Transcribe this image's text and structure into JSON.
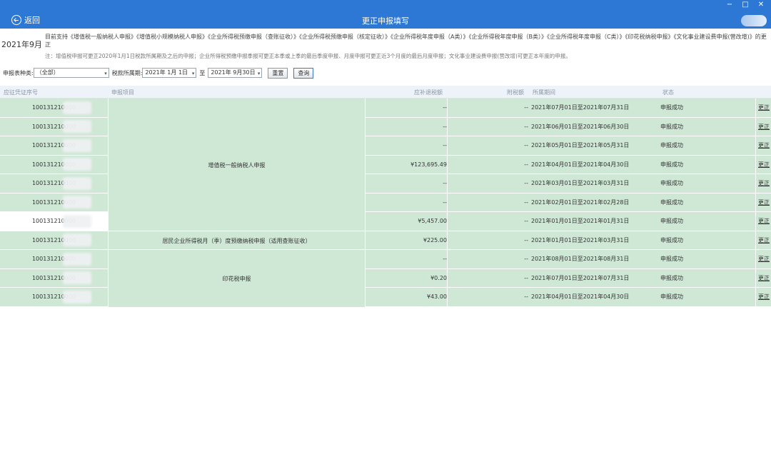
{
  "window": {
    "back_label": "返回",
    "title": "更正申报填写",
    "minimize": "−",
    "maximize": "□",
    "close": "✕"
  },
  "info": {
    "period": "2021年9月",
    "support_text": "目前支持《增值税一般纳税人申报》《增值税小规模纳税人申报》《企业所得税预缴申报（查账征收）》《企业所得税预缴申报（核定征收）》《企业所得税年度申报（A类）》《企业所得税年度申报（B类）》《企业所得税年度申报（C类）》《印花税纳税申报》《文化事业建设费申报(营改增)》的更正",
    "note": "注：增值税申报可更正2020年1月1日税款所属期及之后的申报；企业所得税预缴申报季报可更正本季或上季的最后季度申报、月度申报可更正近3个月度的最后月度申报；文化事业建设费申报(营改增)可更正本年度的申报。"
  },
  "filters": {
    "type_label": "申报表种类:",
    "type_value": "（全部）",
    "period_label": "税款所属期:",
    "start_date": "2021年 1月 1日",
    "to_label": "至",
    "end_date": "2021年 9月30日",
    "reset_label": "重置",
    "query_label": "查询"
  },
  "table": {
    "columns": {
      "id": "应征凭证序号",
      "item": "申报项目",
      "amount": "应补退税额",
      "surtax": "附税额",
      "period": "所属期间",
      "status": "状态"
    },
    "groups": [
      {
        "name": "增值税一般纳税人申报"
      },
      {
        "name": "居民企业所得税月（季）度预缴纳税申报（适用查账征收）"
      },
      {
        "name": "印花税申报"
      }
    ],
    "rows": [
      {
        "id": "100131210000",
        "amount": "--",
        "surtax": "--",
        "period": "2021年07月01日至2021年07月31日",
        "status": "申报成功",
        "action": "更正"
      },
      {
        "id": "100131210000",
        "amount": "--",
        "surtax": "--",
        "period": "2021年06月01日至2021年06月30日",
        "status": "申报成功",
        "action": "更正"
      },
      {
        "id": "100131210000",
        "amount": "--",
        "surtax": "--",
        "period": "2021年05月01日至2021年05月31日",
        "status": "申报成功",
        "action": "更正"
      },
      {
        "id": "100131210000",
        "amount": "¥123,695.49",
        "surtax": "--",
        "period": "2021年04月01日至2021年04月30日",
        "status": "申报成功",
        "action": "更正"
      },
      {
        "id": "100131210000",
        "amount": "--",
        "surtax": "--",
        "period": "2021年03月01日至2021年03月31日",
        "status": "申报成功",
        "action": "更正"
      },
      {
        "id": "100131210000",
        "amount": "--",
        "surtax": "--",
        "period": "2021年02月01日至2021年02月28日",
        "status": "申报成功",
        "action": "更正"
      },
      {
        "id": "100131210000",
        "amount": "¥5,457.00",
        "surtax": "--",
        "period": "2021年01月01日至2021年01月31日",
        "status": "申报成功",
        "action": "更正"
      },
      {
        "id": "100131210000",
        "amount": "¥225.00",
        "surtax": "--",
        "period": "2021年01月01日至2021年03月31日",
        "status": "申报成功",
        "action": "更正"
      },
      {
        "id": "100131210000",
        "amount": "--",
        "surtax": "--",
        "period": "2021年08月01日至2021年08月31日",
        "status": "申报成功",
        "action": "更正"
      },
      {
        "id": "100131210000",
        "amount": "¥0.20",
        "surtax": "--",
        "period": "2021年07月01日至2021年07月31日",
        "status": "申报成功",
        "action": "更正"
      },
      {
        "id": "100131210000",
        "amount": "¥43.00",
        "surtax": "--",
        "period": "2021年04月01日至2021年04月30日",
        "status": "申报成功",
        "action": "更正"
      }
    ]
  },
  "colors": {
    "titlebar": "#2d78d4",
    "row_bg": "#cfe8d5",
    "link": "#1a5fd0"
  }
}
